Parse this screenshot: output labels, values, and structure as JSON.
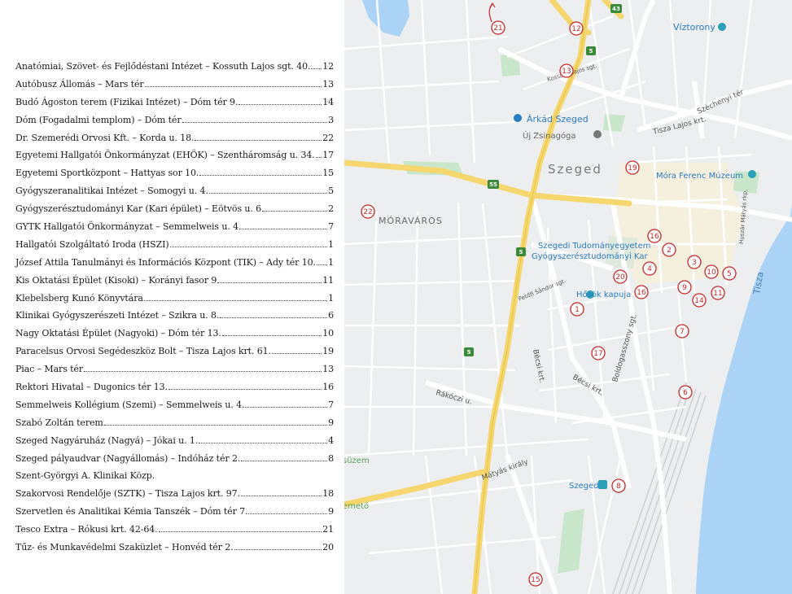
{
  "index": [
    {
      "name": "Anatómiai, Szövet- és Fejlődéstani Intézet – Kossuth Lajos sgt. 40.",
      "page": "12"
    },
    {
      "name": "Autóbusz Állomás – Mars tér",
      "page": "13"
    },
    {
      "name": "Budó Ágoston terem (Fizikai Intézet) – Dóm tér 9.",
      "page": "14"
    },
    {
      "name": "Dóm (Fogadalmi templom) – Dóm tér",
      "page": "3"
    },
    {
      "name": "Dr. Szemerédi Orvosi Kft. – Korda u. 18.",
      "page": "22"
    },
    {
      "name": "Egyetemi Hallgatói Önkormányzat (EHÖK) – Szentháromság u. 34.",
      "page": "17"
    },
    {
      "name": "Egyetemi Sportközpont – Hattyas sor 10.",
      "page": "15"
    },
    {
      "name": "Gyógyszeranalitikai Intézet – Somogyi u. 4.",
      "page": "5"
    },
    {
      "name": "Gyógyszerésztudományi Kar (Kari épület) – Eötvös u. 6",
      "page": "2"
    },
    {
      "name": "GYTK Hallgatói Önkormányzat – Semmelweis u. 4.",
      "page": "7"
    },
    {
      "name": "Hallgatói Szolgáltató Iroda (HSZI)",
      "page": "1"
    },
    {
      "name": "József Attila Tanulmányi és Információs Központ (TIK) – Ady tér 10.",
      "page": "1"
    },
    {
      "name": "Kis Oktatási Épület (Kisoki) – Korányi fasor 9",
      "page": "11"
    },
    {
      "name": "Klebelsberg Kunó Könyvtára",
      "page": "1"
    },
    {
      "name": "Klinikai Gyógyszerészeti Intézet – Szikra u. 8.",
      "page": "6"
    },
    {
      "name": "Nagy Oktatási Épület (Nagyoki) – Dóm tér 13.",
      "page": "10"
    },
    {
      "name": "Paracelsus Orvosi Segédeszköz Bolt – Tisza Lajos krt. 61.",
      "page": "19"
    },
    {
      "name": "Piac – Mars tér",
      "page": "13"
    },
    {
      "name": "Rektori Hivatal – Dugonics tér 13.",
      "page": "16"
    },
    {
      "name": "Semmelweis Kollégium (Szemi) – Semmelweis u. 4.",
      "page": "7"
    },
    {
      "name": "Szabó Zoltán terem",
      "page": "9"
    },
    {
      "name": "Szeged Nagyáruház (Nagyá) – Jókai u. 1.",
      "page": "4"
    },
    {
      "name": "Szeged pályaudvar (Nagyállomás) – Indóház tér 2.",
      "page": "8"
    },
    {
      "name": "Szent-Györgyi A. Klinikai Közp.",
      "page": ""
    },
    {
      "name": "Szakorvosi Rendelője (SZTK) – Tisza Lajos krt. 97.",
      "page": "18"
    },
    {
      "name": "Szervetlen és Analitikai Kémia Tanszék – Dóm tér 7.",
      "page": "9"
    },
    {
      "name": "Tesco Extra – Rókusi krt. 42-64.",
      "page": "21"
    },
    {
      "name": "Tűz- és Munkavédelmi Szaküzlet – Honvéd tér 2.",
      "page": "20"
    }
  ],
  "map": {
    "pois": {
      "viztorony": "Víztorony",
      "arkad": "Árkád Szeged",
      "zsinagoga": "Új Zsinagóga",
      "szeged": "Szeged",
      "mora": "Móra Ferenc Múzeum",
      "moravaros": "MÓRAVÁROS",
      "szte1": "Szegedi Tudományegyetem",
      "szte2": "Gyógyszerésztudományi Kar",
      "hosok": "Hősök kapuja",
      "tisza": "Tisza",
      "station": "Szeged",
      "edge_suzem": "süzem",
      "edge_temeto": "emető"
    },
    "roads": {
      "tisza_lajos_krt": "Tisza Lajos krt.",
      "szechenyi_ter": "Széchenyi tér",
      "becsi_krt_1": "Bécsi krt.",
      "becsi_krt_2": "Bécsi krt.",
      "rakoczi": "Rákóczi u.",
      "boldogasszony": "Boldogasszony sgt.",
      "matyas": "Mátyás király",
      "petofi": "Petőfi Sándor sgt.",
      "kossuth": "Kossuth Lajos sgt.",
      "huszar": "Huszár Mátyás rkp."
    },
    "route_badges": [
      "43",
      "5",
      "55",
      "5",
      "5"
    ],
    "colors": {
      "marker": "#c62828",
      "highway": "#f5d76e",
      "water": "#aad3f5",
      "park": "#c8e6c9",
      "poi_blue": "#2b7bbf"
    },
    "markers": [
      {
        "label": "1"
      },
      {
        "label": "2"
      },
      {
        "label": "4"
      },
      {
        "label": "3"
      },
      {
        "label": "10"
      },
      {
        "label": "5"
      },
      {
        "label": "6"
      },
      {
        "label": "7"
      },
      {
        "label": "8"
      },
      {
        "label": "9"
      },
      {
        "label": "11"
      },
      {
        "label": "12"
      },
      {
        "label": "13"
      },
      {
        "label": "14"
      },
      {
        "label": "15"
      },
      {
        "label": "16"
      },
      {
        "label": "16"
      },
      {
        "label": "17"
      },
      {
        "label": "19"
      },
      {
        "label": "20"
      },
      {
        "label": "21"
      },
      {
        "label": "22"
      }
    ]
  }
}
